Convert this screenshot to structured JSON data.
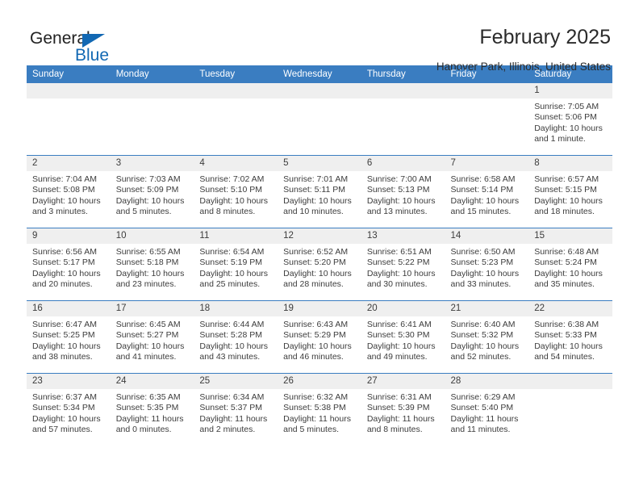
{
  "brand": {
    "name_part1": "General",
    "name_part2": "Blue",
    "logo_icon": "blue-triangle-logo",
    "accent_color": "#1268b3"
  },
  "header": {
    "title": "February 2025",
    "location": "Hanover Park, Illinois, United States"
  },
  "calendar": {
    "header_bg": "#3a7dc1",
    "daynum_bg": "#efefef",
    "weekday_headers": [
      "Sunday",
      "Monday",
      "Tuesday",
      "Wednesday",
      "Thursday",
      "Friday",
      "Saturday"
    ],
    "weeks": [
      [
        {
          "day": "",
          "empty": true
        },
        {
          "day": "",
          "empty": true
        },
        {
          "day": "",
          "empty": true
        },
        {
          "day": "",
          "empty": true
        },
        {
          "day": "",
          "empty": true
        },
        {
          "day": "",
          "empty": true
        },
        {
          "day": "1",
          "sunrise": "Sunrise: 7:05 AM",
          "sunset": "Sunset: 5:06 PM",
          "daylight_line1": "Daylight: 10 hours",
          "daylight_line2": "and 1 minute."
        }
      ],
      [
        {
          "day": "2",
          "sunrise": "Sunrise: 7:04 AM",
          "sunset": "Sunset: 5:08 PM",
          "daylight_line1": "Daylight: 10 hours",
          "daylight_line2": "and 3 minutes."
        },
        {
          "day": "3",
          "sunrise": "Sunrise: 7:03 AM",
          "sunset": "Sunset: 5:09 PM",
          "daylight_line1": "Daylight: 10 hours",
          "daylight_line2": "and 5 minutes."
        },
        {
          "day": "4",
          "sunrise": "Sunrise: 7:02 AM",
          "sunset": "Sunset: 5:10 PM",
          "daylight_line1": "Daylight: 10 hours",
          "daylight_line2": "and 8 minutes."
        },
        {
          "day": "5",
          "sunrise": "Sunrise: 7:01 AM",
          "sunset": "Sunset: 5:11 PM",
          "daylight_line1": "Daylight: 10 hours",
          "daylight_line2": "and 10 minutes."
        },
        {
          "day": "6",
          "sunrise": "Sunrise: 7:00 AM",
          "sunset": "Sunset: 5:13 PM",
          "daylight_line1": "Daylight: 10 hours",
          "daylight_line2": "and 13 minutes."
        },
        {
          "day": "7",
          "sunrise": "Sunrise: 6:58 AM",
          "sunset": "Sunset: 5:14 PM",
          "daylight_line1": "Daylight: 10 hours",
          "daylight_line2": "and 15 minutes."
        },
        {
          "day": "8",
          "sunrise": "Sunrise: 6:57 AM",
          "sunset": "Sunset: 5:15 PM",
          "daylight_line1": "Daylight: 10 hours",
          "daylight_line2": "and 18 minutes."
        }
      ],
      [
        {
          "day": "9",
          "sunrise": "Sunrise: 6:56 AM",
          "sunset": "Sunset: 5:17 PM",
          "daylight_line1": "Daylight: 10 hours",
          "daylight_line2": "and 20 minutes."
        },
        {
          "day": "10",
          "sunrise": "Sunrise: 6:55 AM",
          "sunset": "Sunset: 5:18 PM",
          "daylight_line1": "Daylight: 10 hours",
          "daylight_line2": "and 23 minutes."
        },
        {
          "day": "11",
          "sunrise": "Sunrise: 6:54 AM",
          "sunset": "Sunset: 5:19 PM",
          "daylight_line1": "Daylight: 10 hours",
          "daylight_line2": "and 25 minutes."
        },
        {
          "day": "12",
          "sunrise": "Sunrise: 6:52 AM",
          "sunset": "Sunset: 5:20 PM",
          "daylight_line1": "Daylight: 10 hours",
          "daylight_line2": "and 28 minutes."
        },
        {
          "day": "13",
          "sunrise": "Sunrise: 6:51 AM",
          "sunset": "Sunset: 5:22 PM",
          "daylight_line1": "Daylight: 10 hours",
          "daylight_line2": "and 30 minutes."
        },
        {
          "day": "14",
          "sunrise": "Sunrise: 6:50 AM",
          "sunset": "Sunset: 5:23 PM",
          "daylight_line1": "Daylight: 10 hours",
          "daylight_line2": "and 33 minutes."
        },
        {
          "day": "15",
          "sunrise": "Sunrise: 6:48 AM",
          "sunset": "Sunset: 5:24 PM",
          "daylight_line1": "Daylight: 10 hours",
          "daylight_line2": "and 35 minutes."
        }
      ],
      [
        {
          "day": "16",
          "sunrise": "Sunrise: 6:47 AM",
          "sunset": "Sunset: 5:25 PM",
          "daylight_line1": "Daylight: 10 hours",
          "daylight_line2": "and 38 minutes."
        },
        {
          "day": "17",
          "sunrise": "Sunrise: 6:45 AM",
          "sunset": "Sunset: 5:27 PM",
          "daylight_line1": "Daylight: 10 hours",
          "daylight_line2": "and 41 minutes."
        },
        {
          "day": "18",
          "sunrise": "Sunrise: 6:44 AM",
          "sunset": "Sunset: 5:28 PM",
          "daylight_line1": "Daylight: 10 hours",
          "daylight_line2": "and 43 minutes."
        },
        {
          "day": "19",
          "sunrise": "Sunrise: 6:43 AM",
          "sunset": "Sunset: 5:29 PM",
          "daylight_line1": "Daylight: 10 hours",
          "daylight_line2": "and 46 minutes."
        },
        {
          "day": "20",
          "sunrise": "Sunrise: 6:41 AM",
          "sunset": "Sunset: 5:30 PM",
          "daylight_line1": "Daylight: 10 hours",
          "daylight_line2": "and 49 minutes."
        },
        {
          "day": "21",
          "sunrise": "Sunrise: 6:40 AM",
          "sunset": "Sunset: 5:32 PM",
          "daylight_line1": "Daylight: 10 hours",
          "daylight_line2": "and 52 minutes."
        },
        {
          "day": "22",
          "sunrise": "Sunrise: 6:38 AM",
          "sunset": "Sunset: 5:33 PM",
          "daylight_line1": "Daylight: 10 hours",
          "daylight_line2": "and 54 minutes."
        }
      ],
      [
        {
          "day": "23",
          "sunrise": "Sunrise: 6:37 AM",
          "sunset": "Sunset: 5:34 PM",
          "daylight_line1": "Daylight: 10 hours",
          "daylight_line2": "and 57 minutes."
        },
        {
          "day": "24",
          "sunrise": "Sunrise: 6:35 AM",
          "sunset": "Sunset: 5:35 PM",
          "daylight_line1": "Daylight: 11 hours",
          "daylight_line2": "and 0 minutes."
        },
        {
          "day": "25",
          "sunrise": "Sunrise: 6:34 AM",
          "sunset": "Sunset: 5:37 PM",
          "daylight_line1": "Daylight: 11 hours",
          "daylight_line2": "and 2 minutes."
        },
        {
          "day": "26",
          "sunrise": "Sunrise: 6:32 AM",
          "sunset": "Sunset: 5:38 PM",
          "daylight_line1": "Daylight: 11 hours",
          "daylight_line2": "and 5 minutes."
        },
        {
          "day": "27",
          "sunrise": "Sunrise: 6:31 AM",
          "sunset": "Sunset: 5:39 PM",
          "daylight_line1": "Daylight: 11 hours",
          "daylight_line2": "and 8 minutes."
        },
        {
          "day": "28",
          "sunrise": "Sunrise: 6:29 AM",
          "sunset": "Sunset: 5:40 PM",
          "daylight_line1": "Daylight: 11 hours",
          "daylight_line2": "and 11 minutes."
        },
        {
          "day": "",
          "empty": true
        }
      ]
    ]
  }
}
